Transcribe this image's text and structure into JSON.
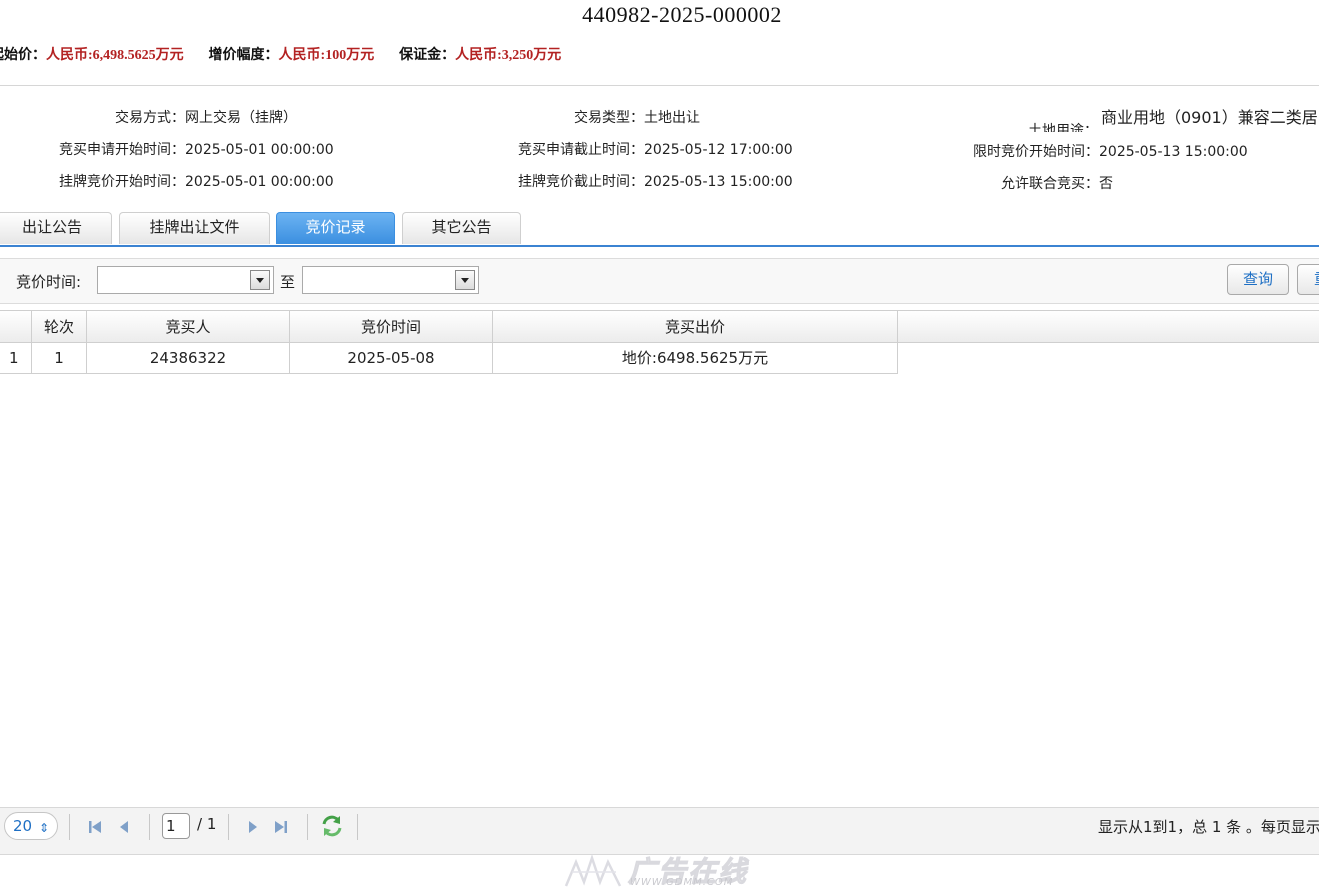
{
  "header": {
    "title": "440982-2025-000002",
    "start_price_label": "起始价：",
    "start_price_value": "人民币:6,498.5625万元",
    "increment_label": "增价幅度：",
    "increment_value": "人民币:100万元",
    "deposit_label": "保证金：",
    "deposit_value": "人民币:3,250万元"
  },
  "info": {
    "trade_method_label": "交易方式：",
    "trade_method_value": "网上交易（挂牌）",
    "trade_type_label": "交易类型：",
    "trade_type_value": "土地出让",
    "land_use_label": "土地用途：",
    "land_use_value": "商业用地（0901）兼容二类居",
    "apply_start_label": "竞买申请开始时间：",
    "apply_start_value": "2025-05-01 00:00:00",
    "apply_end_label": "竞买申请截止时间：",
    "apply_end_value": "2025-05-12 17:00:00",
    "limit_start_label": "限时竞价开始时间：",
    "limit_start_value": "2025-05-13 15:00:00",
    "listing_start_label": "挂牌竞价开始时间：",
    "listing_start_value": "2025-05-01 00:00:00",
    "listing_end_label": "挂牌竞价截止时间：",
    "listing_end_value": "2025-05-13 15:00:00",
    "joint_label": "允许联合竞买：",
    "joint_value": "否"
  },
  "tabs": [
    {
      "label": "出让公告"
    },
    {
      "label": "挂牌出让文件"
    },
    {
      "label": "竞价记录",
      "active": true
    },
    {
      "label": "其它公告"
    }
  ],
  "toolbar": {
    "time_label": "竞价时间:",
    "to_label": "至",
    "query_button": "查询",
    "reset_button": "重置"
  },
  "table": {
    "headers": [
      "轮次",
      "竞买人",
      "竞价时间",
      "竞买出价"
    ],
    "rows": [
      {
        "index": "1",
        "round": "1",
        "bidder": "24386322",
        "time": "2025-05-08",
        "price": "地价:6498.5625万元"
      }
    ]
  },
  "pager": {
    "page_size": "20",
    "current_page": "1",
    "total_pages": "/ 1",
    "info": "显示从1到1，总 1 条 。每页显示"
  },
  "watermark": {
    "text": "广告在线",
    "url": "WWW.GDMM.COM"
  },
  "colors": {
    "accent": "#3b8fe0",
    "price_red": "#b32222",
    "link_blue": "#1e6fc4"
  }
}
